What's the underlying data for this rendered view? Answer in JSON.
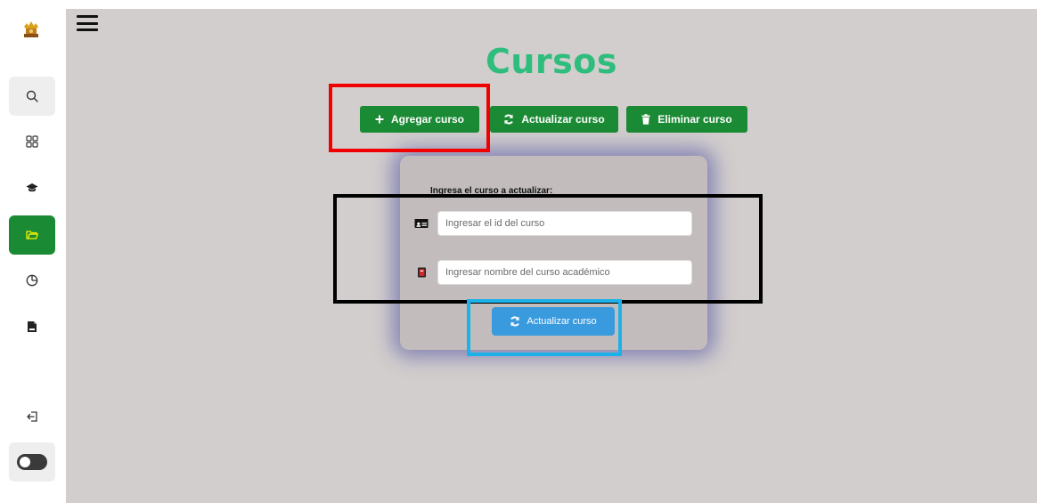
{
  "colors": {
    "brand_green": "#1a8a34",
    "title_green": "#2ebd7c",
    "action_blue": "#3a9ade",
    "main_bg": "#d2cecd",
    "card_bg": "#c2bdbc",
    "annotation_red": "#f00000",
    "annotation_black": "#000000",
    "annotation_blue": "#1ab2e8"
  },
  "sidebar": {
    "items": [
      {
        "icon": "logo-icon",
        "active": false
      },
      {
        "icon": "search-icon",
        "active": false
      },
      {
        "icon": "grid-icon",
        "active": false
      },
      {
        "icon": "graduation-cap-icon",
        "active": false
      },
      {
        "icon": "folder-icon",
        "active": true
      },
      {
        "icon": "clock-icon",
        "active": false
      },
      {
        "icon": "file-icon",
        "active": false
      },
      {
        "icon": "logout-icon",
        "active": false
      },
      {
        "icon": "theme-toggle",
        "active": false
      }
    ]
  },
  "header": {
    "menu_icon": "hamburger-icon",
    "title": "Cursos"
  },
  "toolbar": {
    "add_label": "Agregar curso",
    "update_label": "Actualizar curso",
    "delete_label": "Eliminar curso"
  },
  "form": {
    "label": "Ingresa el curso a actualizar:",
    "id_placeholder": "Ingresar el id del curso",
    "name_placeholder": "Ingresar nombre del curso académico",
    "submit_label": "Actualizar curso"
  }
}
